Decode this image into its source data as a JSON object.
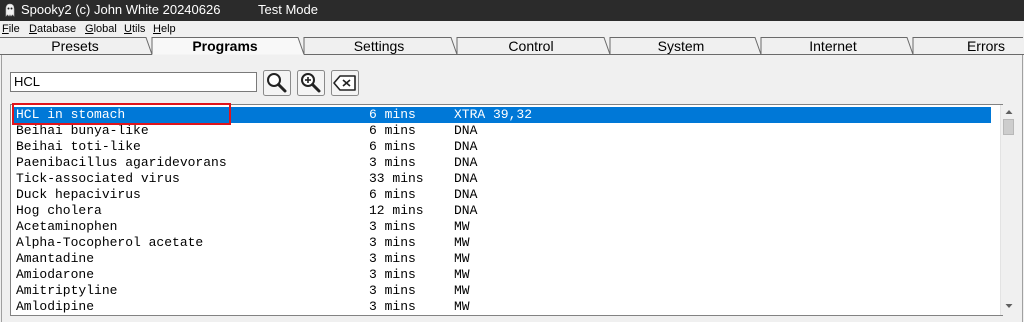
{
  "window": {
    "title": "Spooky2 (c) John White 20240626",
    "mode": "Test Mode"
  },
  "menu": [
    {
      "pre": "",
      "key": "F",
      "post": "ile"
    },
    {
      "pre": "",
      "key": "D",
      "post": "atabase"
    },
    {
      "pre": "",
      "key": "G",
      "post": "lobal"
    },
    {
      "pre": "",
      "key": "U",
      "post": "tils"
    },
    {
      "pre": "",
      "key": "H",
      "post": "elp"
    }
  ],
  "tabs": [
    {
      "label": "Presets",
      "active": false
    },
    {
      "label": "Programs",
      "active": true
    },
    {
      "label": "Settings",
      "active": false
    },
    {
      "label": "Control",
      "active": false
    },
    {
      "label": "System",
      "active": false
    },
    {
      "label": "Internet",
      "active": false
    },
    {
      "label": "Errors",
      "active": false
    }
  ],
  "search": {
    "value": "HCL"
  },
  "toolbar": {
    "search_icon": "magnifier-icon",
    "zoom_icon": "zoom-in-icon",
    "clear_icon": "clear-backspace-icon"
  },
  "programs": [
    {
      "name": "HCL in stomach",
      "duration": "6 mins",
      "type": "XTRA 39,32",
      "selected": true
    },
    {
      "name": "Beihai bunya-like",
      "duration": "6 mins",
      "type": "DNA"
    },
    {
      "name": "Beihai toti-like",
      "duration": "6 mins",
      "type": "DNA"
    },
    {
      "name": "Paenibacillus agaridevorans",
      "duration": "3 mins",
      "type": "DNA"
    },
    {
      "name": "Tick-associated virus",
      "duration": "33 mins",
      "type": "DNA"
    },
    {
      "name": "Duck hepacivirus",
      "duration": "6 mins",
      "type": "DNA"
    },
    {
      "name": "Hog cholera",
      "duration": "12 mins",
      "type": "DNA"
    },
    {
      "name": "Acetaminophen",
      "duration": "3 mins",
      "type": "MW"
    },
    {
      "name": "Alpha-Tocopherol acetate",
      "duration": "3 mins",
      "type": "MW"
    },
    {
      "name": "Amantadine",
      "duration": "3 mins",
      "type": "MW"
    },
    {
      "name": "Amiodarone",
      "duration": "3 mins",
      "type": "MW"
    },
    {
      "name": "Amitriptyline",
      "duration": "3 mins",
      "type": "MW"
    },
    {
      "name": "Amlodipine",
      "duration": "3 mins",
      "type": "MW"
    }
  ],
  "colors": {
    "selection": "#0078d7",
    "annotation": "#e0141b",
    "titlebar": "#2b2b2b"
  }
}
